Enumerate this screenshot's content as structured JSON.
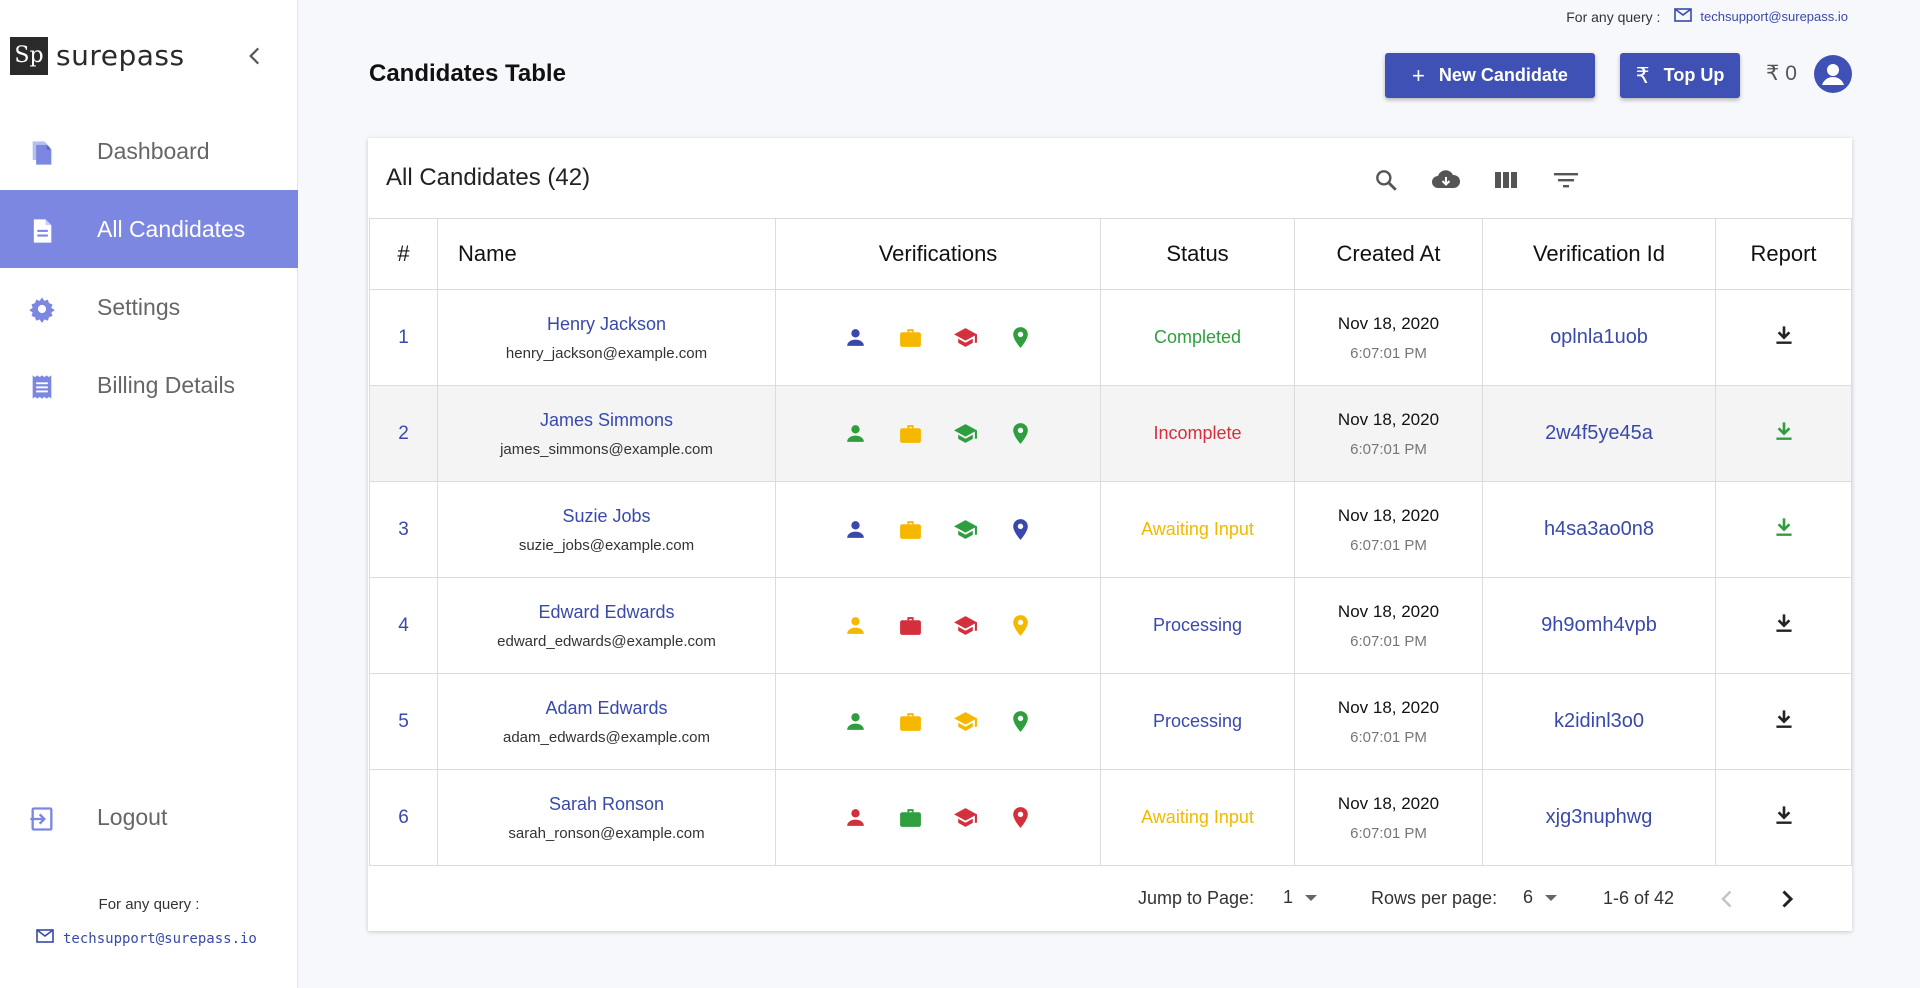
{
  "sidebar": {
    "logo_mark": "Sp",
    "logo_text": "surepass",
    "items": [
      {
        "label": "Dashboard",
        "icon": "file-copy-icon"
      },
      {
        "label": "All Candidates",
        "icon": "document-icon"
      },
      {
        "label": "Settings",
        "icon": "gear-icon"
      },
      {
        "label": "Billing Details",
        "icon": "receipt-icon"
      }
    ],
    "logout_label": "Logout",
    "query_label": "For any query :",
    "support_email": "techsupport@surepass.io"
  },
  "topbar": {
    "query_label": "For any query :",
    "support_email": "techsupport@surepass.io",
    "page_title": "Candidates Table",
    "new_candidate_label": "New Candidate",
    "top_up_label": "Top Up",
    "top_up_symbol": "₹",
    "balance": "₹ 0"
  },
  "table": {
    "title": "All Candidates (42)",
    "tools": [
      "search-icon",
      "cloud-download-icon",
      "columns-icon",
      "filter-icon"
    ],
    "headers": {
      "index": "#",
      "name": "Name",
      "verifications": "Verifications",
      "status": "Status",
      "created": "Created At",
      "verification_id": "Verification Id",
      "report": "Report"
    },
    "rows": [
      {
        "index": "1",
        "name": "Henry Jackson",
        "email": "henry_jackson@example.com",
        "verifications": [
          "#3949ab",
          "#f5b800",
          "#d32f3c",
          "#2e9e3e"
        ],
        "status": "Completed",
        "status_color": "#2e9e3e",
        "date": "Nov 18, 2020",
        "time": "6:07:01 PM",
        "verification_id": "oplnla1uob",
        "report_color": "#222222"
      },
      {
        "index": "2",
        "name": "James Simmons",
        "email": "james_simmons@example.com",
        "verifications": [
          "#2e9e3e",
          "#f5b800",
          "#2e9e3e",
          "#2e9e3e"
        ],
        "status": "Incomplete",
        "status_color": "#d32f3c",
        "date": "Nov 18, 2020",
        "time": "6:07:01 PM",
        "verification_id": "2w4f5ye45a",
        "report_color": "#2e9e3e"
      },
      {
        "index": "3",
        "name": "Suzie Jobs",
        "email": "suzie_jobs@example.com",
        "verifications": [
          "#3949ab",
          "#f5b800",
          "#2e9e3e",
          "#3949ab"
        ],
        "status": "Awaiting Input",
        "status_color": "#f5b800",
        "date": "Nov 18, 2020",
        "time": "6:07:01 PM",
        "verification_id": "h4sa3ao0n8",
        "report_color": "#2e9e3e"
      },
      {
        "index": "4",
        "name": "Edward Edwards",
        "email": "edward_edwards@example.com",
        "verifications": [
          "#f5b800",
          "#d32f3c",
          "#d32f3c",
          "#f5b800"
        ],
        "status": "Processing",
        "status_color": "#3949ab",
        "date": "Nov 18, 2020",
        "time": "6:07:01 PM",
        "verification_id": "9h9omh4vpb",
        "report_color": "#222222"
      },
      {
        "index": "5",
        "name": "Adam Edwards",
        "email": "adam_edwards@example.com",
        "verifications": [
          "#2e9e3e",
          "#f5b800",
          "#f5b800",
          "#2e9e3e"
        ],
        "status": "Processing",
        "status_color": "#3949ab",
        "date": "Nov 18, 2020",
        "time": "6:07:01 PM",
        "verification_id": "k2idinl3o0",
        "report_color": "#222222"
      },
      {
        "index": "6",
        "name": "Sarah Ronson",
        "email": "sarah_ronson@example.com",
        "verifications": [
          "#d32f3c",
          "#2e9e3e",
          "#d32f3c",
          "#d32f3c"
        ],
        "status": "Awaiting Input",
        "status_color": "#f5b800",
        "date": "Nov 18, 2020",
        "time": "6:07:01 PM",
        "verification_id": "xjg3nuphwg",
        "report_color": "#222222"
      }
    ],
    "verification_icon_names": [
      "person-icon",
      "briefcase-icon",
      "graduation-cap-icon",
      "location-pin-icon"
    ],
    "footer": {
      "jump_label": "Jump to Page:",
      "jump_value": "1",
      "rows_label": "Rows per page:",
      "rows_value": "6",
      "range": "1-6 of 42"
    }
  },
  "colors": {
    "accent": "#3f51b5",
    "sidebar_active": "#7b87e0",
    "sidebar_icon": "#7b87e0"
  }
}
